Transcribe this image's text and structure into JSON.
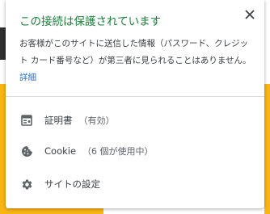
{
  "popup": {
    "title": "この接続は保護されています",
    "description": "お客様がこのサイトに送信した情報（パスワード、クレジット カード番号など）が第三者に見られることはありません。",
    "details_link": "詳細",
    "close_icon": "close-icon"
  },
  "rows": [
    {
      "icon": "certificate-icon",
      "label": "証明書",
      "sub": "（有効）"
    },
    {
      "icon": "cookie-icon",
      "label": "Cookie",
      "sub": "（6 個が使用中）"
    },
    {
      "icon": "gear-icon",
      "label": "サイトの設定",
      "sub": ""
    }
  ],
  "colors": {
    "title_green": "#188038",
    "link_blue": "#1a73e8",
    "text": "#3c4043",
    "icon_gray": "#5f6368",
    "background_yellow": "#f9b514"
  }
}
